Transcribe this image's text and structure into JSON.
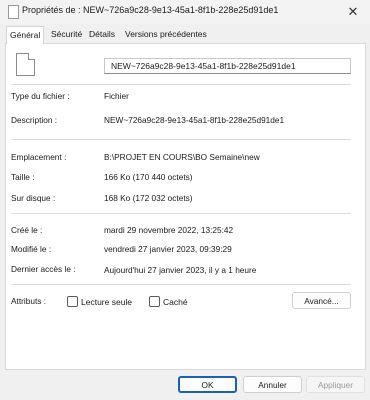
{
  "window": {
    "title": "Propriétés de : NEW~726a9c28-9e13-45a1-8f1b-228e25d91de1",
    "close_icon": "close-icon"
  },
  "tabs": [
    {
      "label": "Général",
      "active": true
    },
    {
      "label": "Sécurité",
      "active": false
    },
    {
      "label": "Détails",
      "active": false
    },
    {
      "label": "Versions précédentes",
      "active": false
    }
  ],
  "general": {
    "file_name": "NEW~726a9c28-9e13-45a1-8f1b-228e25d91de1",
    "type_label": "Type du fichier :",
    "type_value": "Fichier",
    "description_label": "Description :",
    "description_value": "NEW~726a9c28-9e13-45a1-8f1b-228e25d91de1",
    "location_label": "Emplacement :",
    "location_value": "B:\\PROJET EN COURS\\BO Semaine\\new",
    "size_label": "Taille :",
    "size_value": "166 Ko (170 440 octets)",
    "disk_size_label": "Sur disque :",
    "disk_size_value": "168 Ko (172 032 octets)",
    "created_label": "Créé le :",
    "created_value": "mardi 29 novembre 2022, 13:25:42",
    "modified_label": "Modifié le :",
    "modified_value": "vendredi 27 janvier 2023, 09:39:29",
    "accessed_label": "Dernier accès le :",
    "accessed_value": "Aujourd'hui 27 janvier 2023, il y a 1 heure",
    "attributes_label": "Attributs :",
    "readonly_label": "Lecture seule",
    "readonly_checked": false,
    "hidden_label": "Caché",
    "hidden_checked": false,
    "advanced_label": "Avancé..."
  },
  "footer": {
    "ok_label": "OK",
    "cancel_label": "Annuler",
    "apply_label": "Appliquer"
  },
  "colors": {
    "accent": "#1e5fb4"
  }
}
